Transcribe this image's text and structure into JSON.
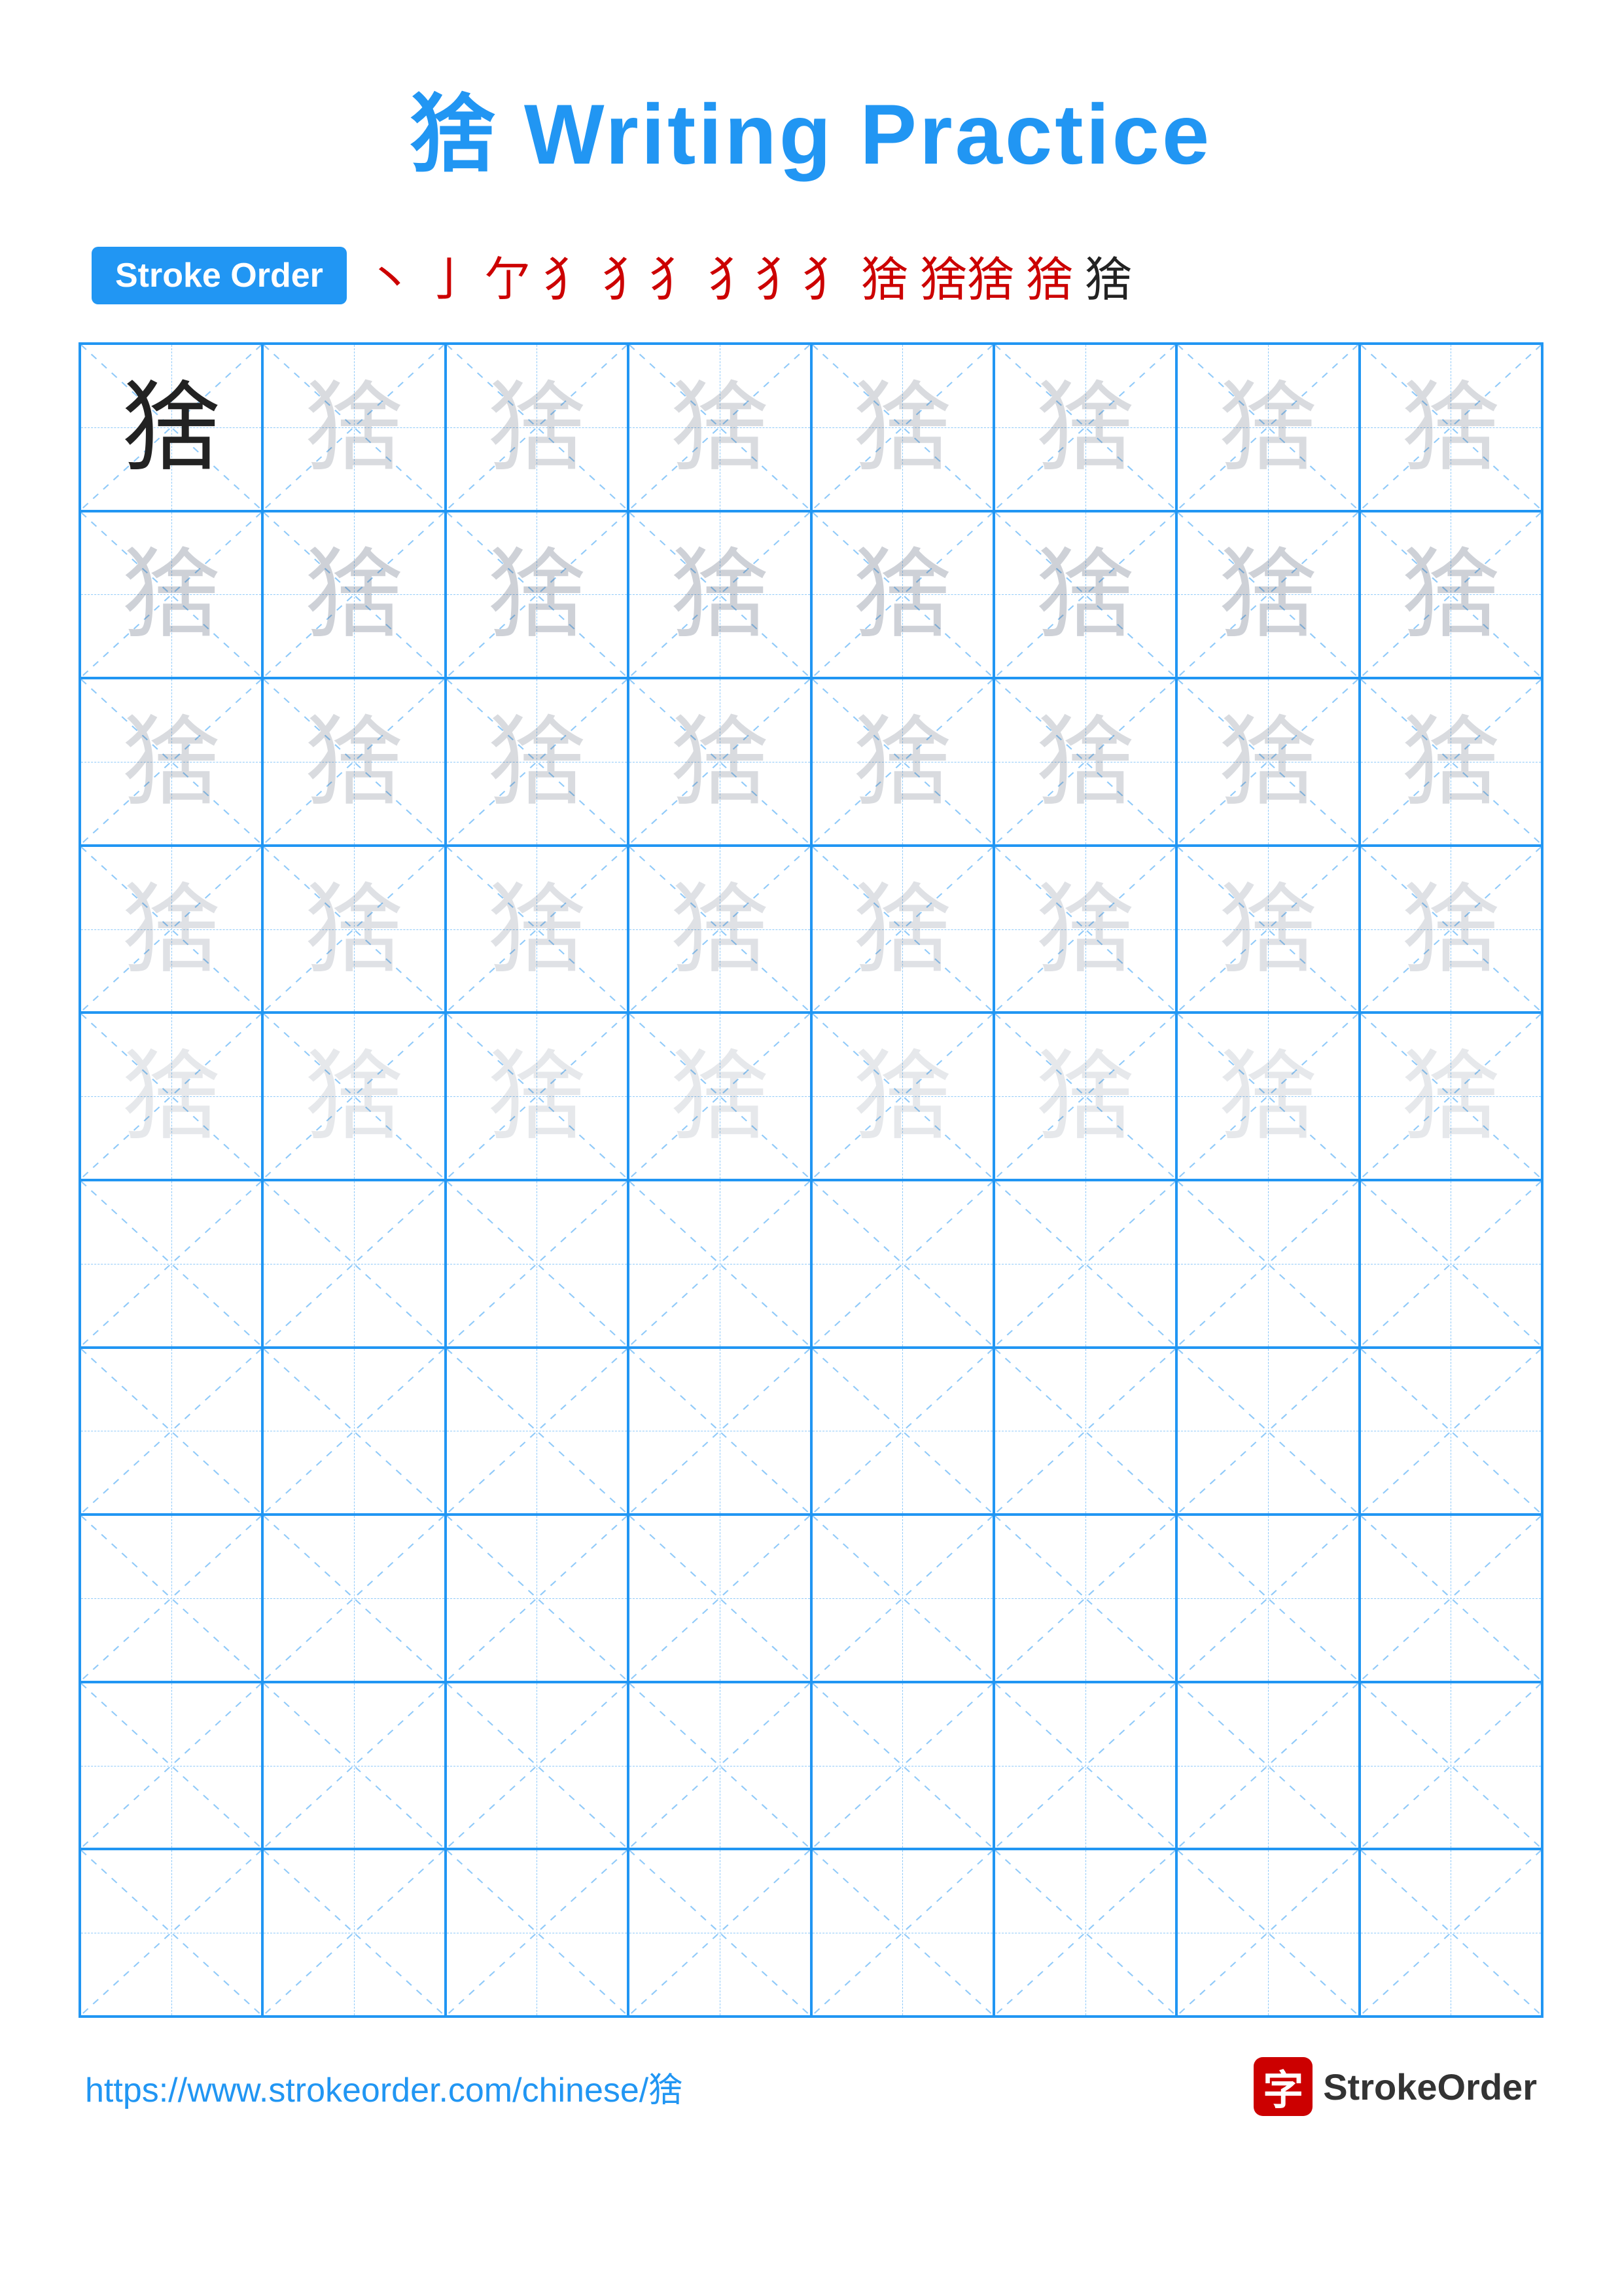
{
  "title": "猞 Writing Practice",
  "stroke_order_badge": "Stroke Order",
  "stroke_sequence": [
    "丶",
    "亅",
    "亅",
    "亻",
    "犭",
    "犭犭",
    "犭犭犭",
    "犭犭犭犭",
    "猞犭",
    "猞"
  ],
  "character": "猞",
  "grid": {
    "cols": 8,
    "rows": 10,
    "practice_rows": 5,
    "empty_rows": 5
  },
  "footer": {
    "url": "https://www.strokeorder.com/chinese/猞",
    "logo_text": "StrokeOrder",
    "logo_char": "字"
  }
}
